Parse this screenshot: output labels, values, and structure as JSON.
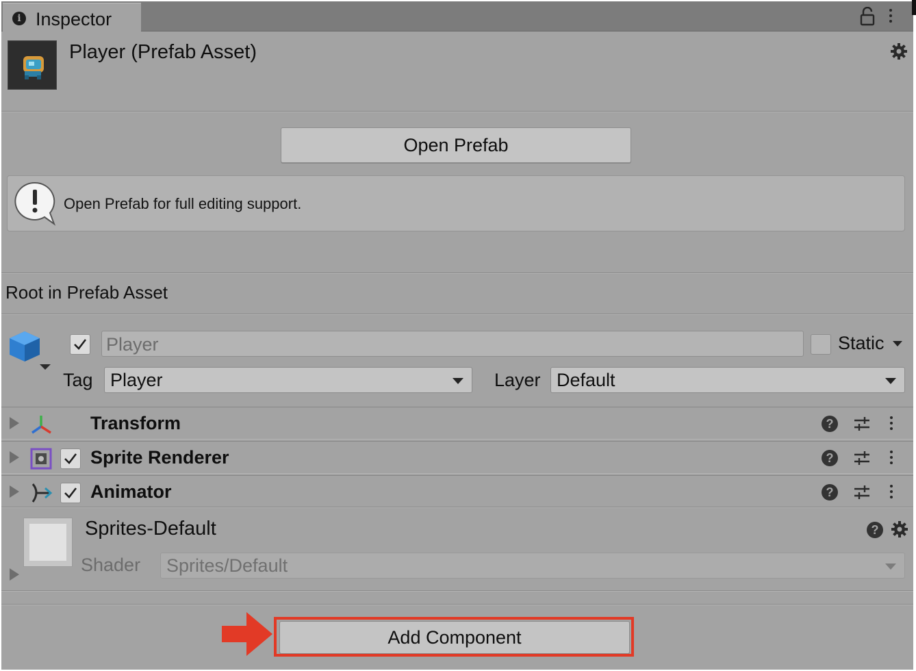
{
  "tab": {
    "title": "Inspector",
    "info_icon": "info-icon"
  },
  "header": {
    "title": "Player (Prefab Asset)"
  },
  "open_prefab_button": "Open Prefab",
  "helpbox": {
    "message": "Open Prefab for full editing support.",
    "icon": "warning-icon"
  },
  "section_label": "Root in Prefab Asset",
  "gameobject": {
    "name": "Player",
    "active": true,
    "static_label": "Static",
    "static": false,
    "tag_label": "Tag",
    "tag_value": "Player",
    "layer_label": "Layer",
    "layer_value": "Default"
  },
  "components": [
    {
      "name": "Transform",
      "icon": "transform-icon",
      "has_checkbox": false
    },
    {
      "name": "Sprite Renderer",
      "icon": "sprite-renderer-icon",
      "has_checkbox": true,
      "enabled": true
    },
    {
      "name": "Animator",
      "icon": "animator-icon",
      "has_checkbox": true,
      "enabled": true
    }
  ],
  "material": {
    "name": "Sprites-Default",
    "shader_label": "Shader",
    "shader_value": "Sprites/Default"
  },
  "add_component_button": "Add Component",
  "colors": {
    "panel_bg": "#a3a3a3",
    "tabbar_bg": "#7c7c7c",
    "button_bg": "#c4c4c4",
    "highlight_red": "#e23a26",
    "gameobject_icon_blue": "#2f7fd0"
  }
}
